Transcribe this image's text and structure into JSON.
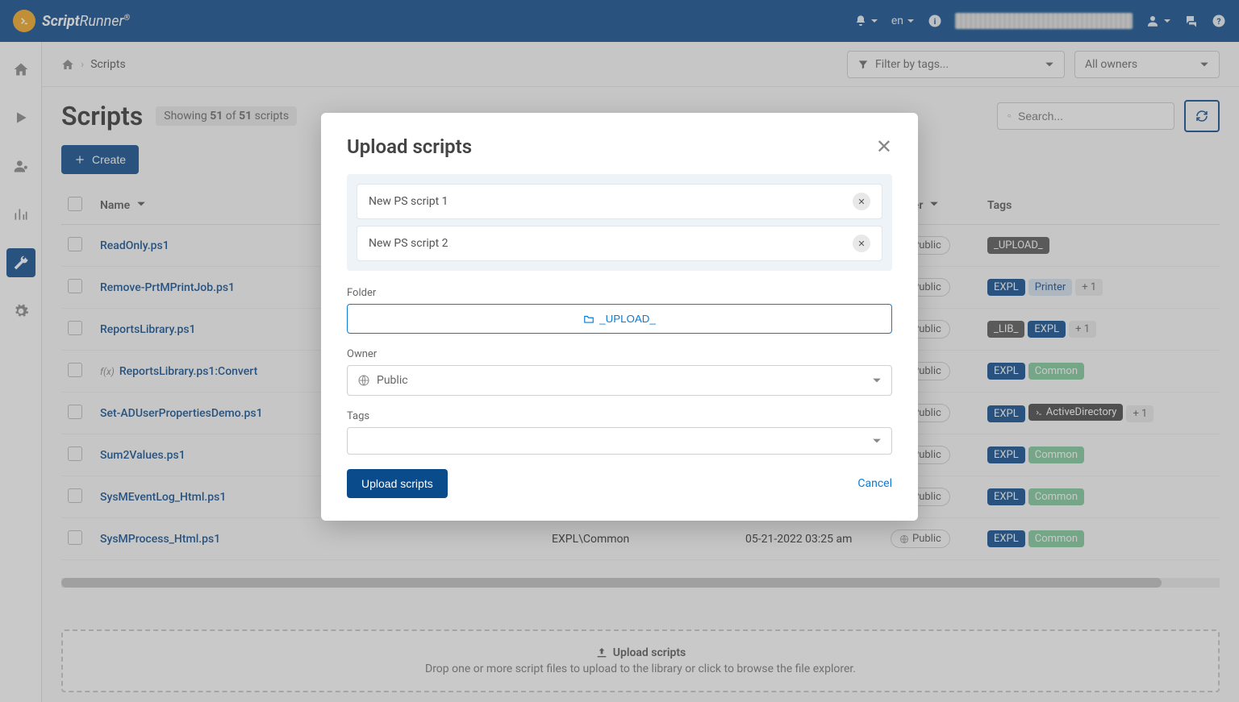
{
  "header": {
    "brand_script": "Script",
    "brand_runner": "Runner",
    "brand_reg": "®",
    "lang": "en"
  },
  "breadcrumb": {
    "section": "Scripts"
  },
  "filters": {
    "tags_placeholder": "Filter by tags...",
    "owners_label": "All owners"
  },
  "page": {
    "title": "Scripts",
    "showing_prefix": "Showing ",
    "showing_count": "51",
    "showing_of": " of ",
    "showing_total": "51",
    "showing_suffix": " scripts",
    "create_label": "Create",
    "search_placeholder": "Search..."
  },
  "columns": {
    "name": "Name",
    "owner": "Owner",
    "tags": "Tags"
  },
  "rows": [
    {
      "name": "ReadOnly.ps1",
      "owner": "Public",
      "tags": [
        {
          "t": "_UPLOAD_",
          "cls": "tag-upload"
        }
      ]
    },
    {
      "name": "Remove-PrtMPrintJob.ps1",
      "owner": "Public",
      "tags": [
        {
          "t": "EXPL",
          "cls": "tag-expl"
        },
        {
          "t": "Printer",
          "cls": "tag-printer"
        },
        {
          "t": "+ 1",
          "cls": "tag-more"
        }
      ]
    },
    {
      "name": "ReportsLibrary.ps1",
      "owner": "Public",
      "tags": [
        {
          "t": "_LIB_",
          "cls": "tag-lib"
        },
        {
          "t": "EXPL",
          "cls": "tag-expl"
        },
        {
          "t": "+ 1",
          "cls": "tag-more"
        }
      ]
    },
    {
      "name": "ReportsLibrary.ps1:Convert",
      "owner": "Public",
      "fx": true,
      "tags": [
        {
          "t": "EXPL",
          "cls": "tag-expl"
        },
        {
          "t": "Common",
          "cls": "tag-common"
        }
      ]
    },
    {
      "name": "Set-ADUserPropertiesDemo.ps1",
      "owner": "Public",
      "tags": [
        {
          "t": "EXPL",
          "cls": "tag-expl"
        },
        {
          "t": "ActiveDirectory",
          "cls": "tag-ad",
          "icon": true
        },
        {
          "t": "+ 1",
          "cls": "tag-more"
        }
      ]
    },
    {
      "name": "Sum2Values.ps1",
      "owner": "Public",
      "tags": [
        {
          "t": "EXPL",
          "cls": "tag-expl"
        },
        {
          "t": "Common",
          "cls": "tag-common"
        }
      ]
    },
    {
      "name": "SysMEventLog_Html.ps1",
      "owner": "Public",
      "tags": [
        {
          "t": "EXPL",
          "cls": "tag-expl"
        },
        {
          "t": "Common",
          "cls": "tag-common"
        }
      ]
    },
    {
      "name": "SysMProcess_Html.ps1",
      "owner": "Public",
      "path": "EXPL\\Common",
      "date": "05-21-2022 03:25 am",
      "tags": [
        {
          "t": "EXPL",
          "cls": "tag-expl"
        },
        {
          "t": "Common",
          "cls": "tag-common"
        }
      ]
    }
  ],
  "dropzone": {
    "title": "Upload scripts",
    "subtitle": "Drop one or more script files to upload to the library or click to browse the file explorer."
  },
  "modal": {
    "title": "Upload scripts",
    "files": [
      "New PS script 1",
      "New PS script 2"
    ],
    "folder_label": "Folder",
    "folder_value": "_UPLOAD_",
    "owner_label": "Owner",
    "owner_value": "Public",
    "tags_label": "Tags",
    "submit_label": "Upload scripts",
    "cancel_label": "Cancel"
  }
}
